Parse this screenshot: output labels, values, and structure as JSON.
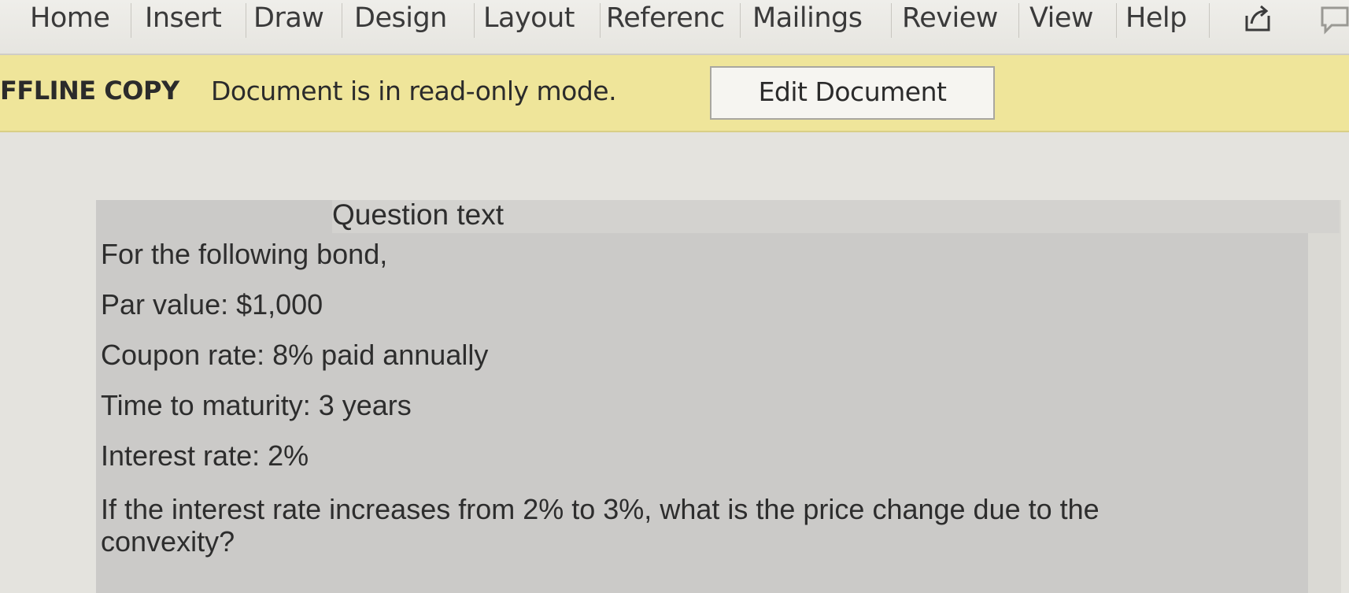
{
  "ribbon": {
    "tabs": [
      {
        "label": "Home"
      },
      {
        "label": "Insert"
      },
      {
        "label": "Draw"
      },
      {
        "label": "Design"
      },
      {
        "label": "Layout"
      },
      {
        "label": "Referenc"
      },
      {
        "label": "Mailings"
      },
      {
        "label": "Review"
      },
      {
        "label": "View"
      },
      {
        "label": "Help"
      }
    ],
    "icons": [
      "share-icon",
      "comment-icon"
    ]
  },
  "banner": {
    "label": "FFLINE COPY",
    "message": "Document is in read-only mode.",
    "edit_button": "Edit Document",
    "background_color": "#efe59a"
  },
  "question": {
    "header": "Question text",
    "intro": "For the following bond,",
    "par_value": "Par value: $1,000",
    "coupon_rate": "Coupon rate: 8% paid annually",
    "time_to_maturity": "Time to maturity: 3 years",
    "interest_rate": "Interest rate: 2%",
    "prompt": "If the interest rate increases from 2% to 3%, what is the price change due to the convexity?"
  }
}
